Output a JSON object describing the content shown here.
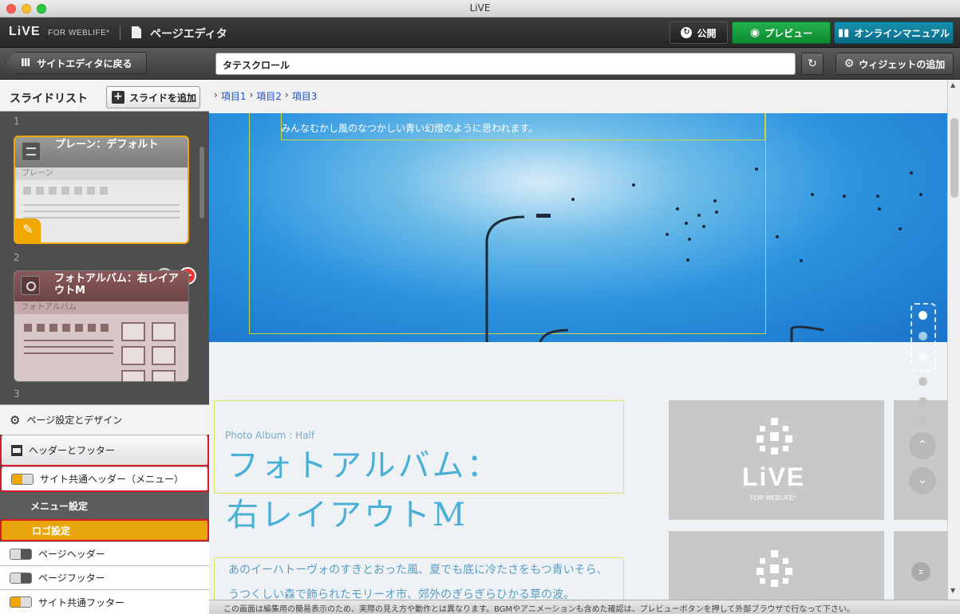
{
  "window": {
    "title": "LiVE"
  },
  "app": {
    "brand": "LiVE",
    "brand_sub": "FOR WEBLIFE*",
    "page_title": "ページエディタ"
  },
  "buttons": {
    "publish": "公開",
    "preview": "プレビュー",
    "manual": "オンラインマニュアル",
    "back": "サイトエディタに戻る",
    "add_widget": "ウィジェットの追加",
    "add_slide": "スライドを追加"
  },
  "title_field": {
    "value": "タテスクロール"
  },
  "slide_list": {
    "heading": "スライドリスト",
    "slides": [
      {
        "number": "1",
        "title": "プレーン：デフォルト",
        "subtitle": "プレーン"
      },
      {
        "number": "2",
        "title": "フォトアルバム：右レイアウトM",
        "subtitle": "フォトアルバム"
      },
      {
        "number": "3"
      }
    ]
  },
  "settings": {
    "page_design": "ページ設定とデザイン",
    "header_footer": "ヘッダーとフッター",
    "common_header": "サイト共通ヘッダー（メニュー）",
    "menu_settings": "メニュー設定",
    "logo_settings": "ロゴ設定",
    "page_header": "ページヘッダー",
    "page_footer": "ページフッター",
    "common_footer": "サイト共通フッター"
  },
  "markers": [
    "1",
    "2",
    "3"
  ],
  "breadcrumb": [
    "項目1",
    "項目2",
    "項目3"
  ],
  "hero": {
    "text": "みんなむかし風のなつかしい青い幻燈のように思われます。"
  },
  "album": {
    "label": "Photo Album : Half",
    "title_line1": "フォトアルバム：",
    "title_line2": "右レイアウトM",
    "body": [
      "あのイーハトーヴォのすきとおった風、夏でも底に冷たさをもつ青いそら、",
      "うつくしい森で飾られたモリーオ市、郊外のぎらぎらひかる草の波。"
    ],
    "logo_text": "LiVE",
    "logo_sub": "FOR WEBLIFE*"
  },
  "status": "この画面は編集用の簡易表示のため、実際の見え方や動作とは異なります。BGMやアニメーションも含めた確認は、プレビューボタンを押して外部ブラウザで行なって下さい。",
  "colors": {
    "accent": "#f0a800",
    "preview": "#16a13f",
    "manual": "#0f7f9e",
    "marker": "#d81a2b",
    "delete": "#ee3333"
  }
}
